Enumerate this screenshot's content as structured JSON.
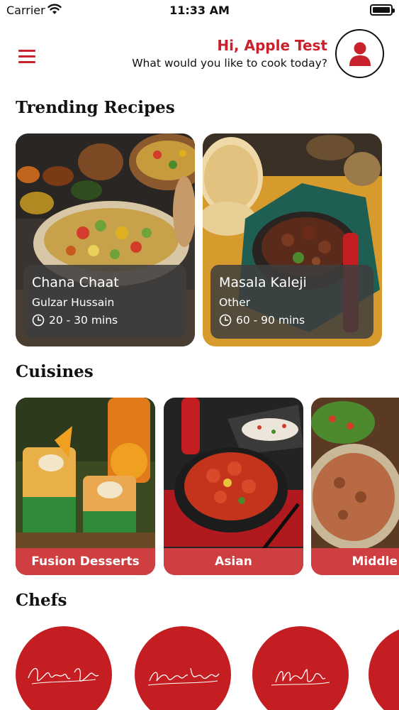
{
  "status_bar": {
    "carrier": "Carrier",
    "time": "11:33 AM"
  },
  "header": {
    "greeting": "Hi, Apple Test",
    "subtitle": "What would you like to cook today?",
    "accent_color": "#c8232c"
  },
  "trending": {
    "title": "Trending Recipes",
    "recipes": [
      {
        "name": "Chana Chaat",
        "chef": "Gulzar Hussain",
        "time": "20 - 30 mins"
      },
      {
        "name": "Masala Kaleji",
        "chef": "Other",
        "time": "60 - 90 mins"
      }
    ]
  },
  "cuisines": {
    "title": "Cuisines",
    "items": [
      {
        "label": "Fusion Desserts"
      },
      {
        "label": "Asian"
      },
      {
        "label": "Middle E"
      }
    ],
    "label_color": "#cf3e41"
  },
  "chefs": {
    "title": "Chefs",
    "circle_color": "#c41e22"
  }
}
